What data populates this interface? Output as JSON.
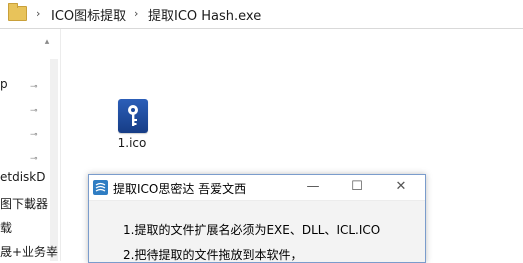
{
  "explorer": {
    "breadcrumbs": [
      "ICO图标提取",
      "提取ICO Hash.exe"
    ],
    "separator": "›",
    "nav_items": [
      "p",
      "",
      "",
      "",
      "etdiskD",
      "图下載器",
      "载",
      "晟+业务峷"
    ]
  },
  "file": {
    "label": "1.ico",
    "icon": "key-file-icon"
  },
  "dialog": {
    "title": "提取ICO思密达  吾爱文西",
    "minimize": "—",
    "maximize": "☐",
    "close": "✕",
    "instructions": [
      "1.提取的文件扩展名必须为EXE、DLL、ICL.ICO",
      "2.把待提取的文件拖放到本软件，"
    ]
  }
}
